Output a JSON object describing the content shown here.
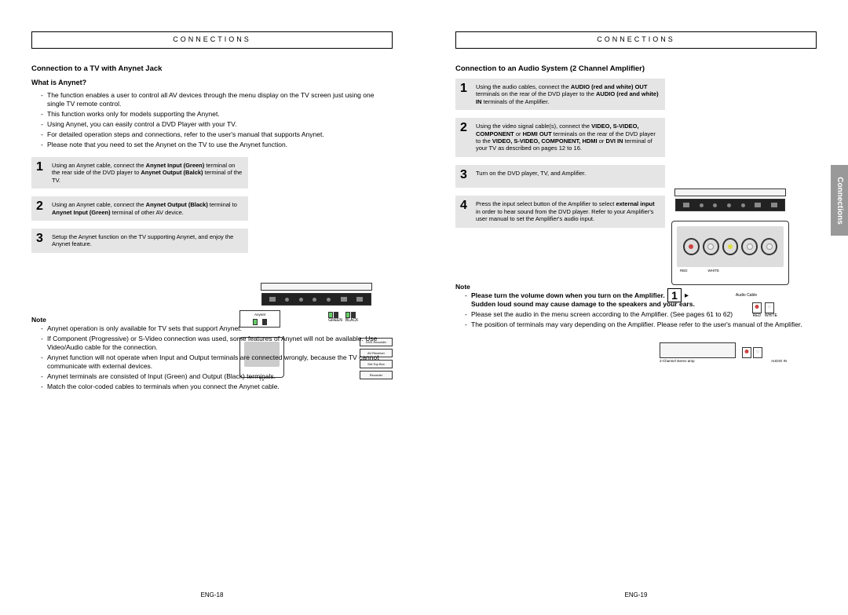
{
  "header": "CONNECTIONS",
  "side_tab": "Connections",
  "left": {
    "title": "Connection to a TV with Anynet Jack",
    "what_is": "What is Anynet?",
    "intro": [
      "The function enables a user to control all AV devices through the menu display on the TV screen just using one single TV remote control.",
      "This function works only for models supporting the Anynet.",
      "Using Anynet, you can easily control a DVD Player with your TV.",
      "For detailed operation steps and connections, refer to the user's manual that supports Anynet.",
      "Please note that you need to set the Anynet on the TV to use the Anynet function."
    ],
    "steps": [
      {
        "num": "1",
        "text_pre": "Using an Anynet cable, connect the ",
        "b1": "Anynet Input (Green)",
        "mid": " terminal on the rear side of the DVD player to ",
        "b2": "Anynet Output (Balck)",
        "post": " terminal of the TV."
      },
      {
        "num": "2",
        "text_pre": "Using an Anynet cable, connect the ",
        "b1": "Anynet Output (Black)",
        "mid": " terminal to ",
        "b2": "Anynet Input (Green)",
        "post": " terminal of other AV device."
      },
      {
        "num": "3",
        "text_pre": "Setup the Anynet function on the TV supporting Anynet, and enjoy the Anynet feature.",
        "b1": "",
        "mid": "",
        "b2": "",
        "post": ""
      }
    ],
    "note_label": "Note",
    "notes": [
      "Anynet operation is only available for TV sets that support Anynet.",
      "If Component (Progressive) or S-Video connection was used, some features of Anynet will not be available. Use Video/Audio cable for the connection.",
      "Anynet function will not operate when Input and Output terminals are connected wrongly, because the TV cannot communicate with external devices.",
      "Anynet terminals are consisted of Input (Green) and Output (Black) terminals.",
      "Match the color-coded cables to terminals when you connect the Anynet cable."
    ],
    "diagram": {
      "devices": [
        "DVD Recorder",
        "AV Receiver",
        "Set-Top Box",
        "Recorder"
      ],
      "jack_labels": [
        "GREEN",
        "BLACK",
        "GREEN",
        "BLACK",
        "GREEN",
        "BLACK"
      ],
      "anynet_label": "Anynet",
      "tv_label": "TV"
    },
    "page_num": "ENG-18"
  },
  "right": {
    "title": "Connection to an Audio System (2 Channel Amplifier)",
    "steps": [
      {
        "num": "1",
        "pre": "Using the audio cables, connect the ",
        "b1": "AUDIO (red and white) OUT",
        "mid": " terminals on the rear of the DVD player to the ",
        "b2": "AUDIO (red and white) IN",
        "post": " terminals of the Amplifier."
      },
      {
        "num": "2",
        "pre": "Using the video signal cable(s), connect the ",
        "b1": "VIDEO, S-VIDEO, COMPONENT",
        "mid": " or ",
        "b1b": "HDMI OUT",
        "mid2": " terminals on the rear of the DVD player to the ",
        "b2": "VIDEO, S-VIDEO, COMPONENT, HDMI",
        "mid3": " or ",
        "b3": "DVI IN",
        "post": " terminal of your TV as described on pages 12 to 16."
      },
      {
        "num": "3",
        "pre": "Turn on the DVD player, TV, and Amplifier."
      },
      {
        "num": "4",
        "pre": "Press the input select button of the Amplifier to select ",
        "b1": "external input",
        "post": " in order to hear sound from the DVD player. Refer to your Amplifier's user manual to set the Amplifier's audio input."
      }
    ],
    "note_label": "Note",
    "note_bold1": "Please turn the volume down when you turn on the Amplifier.",
    "note_bold2": "Sudden loud sound may cause damage to the speakers and your ears.",
    "notes": [
      "Please set the audio in the menu screen according to the Amplifier. (See pages 61 to 62)",
      "The position of terminals may vary depending on the Amplifier. Please refer to the user's manual of the Amplifier."
    ],
    "diagram": {
      "audio_cable": "Audio Cable",
      "red": "RED",
      "white": "WHITE",
      "amp": "2-Channel stereo amp",
      "audio_in": "AUDIO IN"
    },
    "page_num": "ENG-19"
  }
}
